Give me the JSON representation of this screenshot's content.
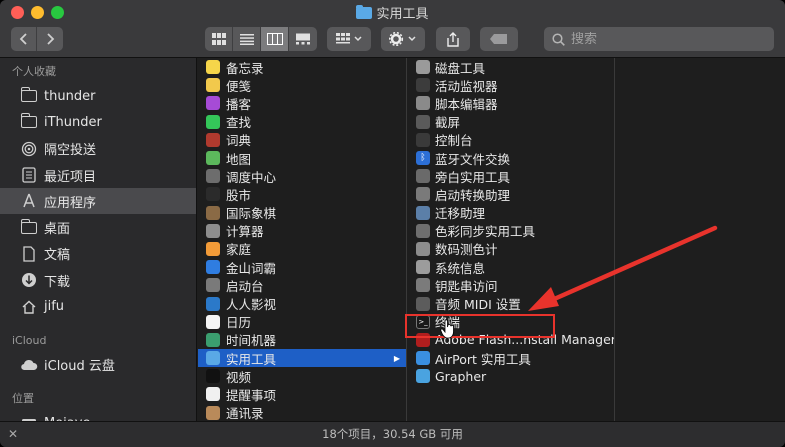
{
  "window": {
    "title": "实用工具"
  },
  "toolbar": {
    "search_placeholder": "搜索",
    "accent": "#1e5fc6"
  },
  "sidebar": {
    "favorites_title": "个人收藏",
    "favorites": [
      {
        "label": "thunder",
        "icon": "folder-icon"
      },
      {
        "label": "iThunder",
        "icon": "folder-icon"
      },
      {
        "label": "隔空投送",
        "icon": "airdrop-icon"
      },
      {
        "label": "最近项目",
        "icon": "recents-icon"
      },
      {
        "label": "应用程序",
        "icon": "applications-icon"
      },
      {
        "label": "桌面",
        "icon": "folder-icon"
      },
      {
        "label": "文稿",
        "icon": "document-icon"
      },
      {
        "label": "下载",
        "icon": "download-icon"
      },
      {
        "label": "jifu",
        "icon": "home-icon"
      }
    ],
    "icloud_title": "iCloud",
    "icloud": [
      {
        "label": "iCloud 云盘",
        "icon": "cloud-icon"
      }
    ],
    "locations_title": "位置",
    "locations": [
      {
        "label": "Mojave",
        "icon": "disk-icon"
      }
    ]
  },
  "applications": [
    {
      "label": "备忘录",
      "icon": "notes-icon",
      "color": "#f5d54a"
    },
    {
      "label": "便笺",
      "icon": "stickies-icon",
      "color": "#f2c94c"
    },
    {
      "label": "播客",
      "icon": "podcasts-icon",
      "color": "#a64bd6"
    },
    {
      "label": "查找",
      "icon": "findmy-icon",
      "color": "#34c759"
    },
    {
      "label": "词典",
      "icon": "dictionary-icon",
      "color": "#b03a2e"
    },
    {
      "label": "地图",
      "icon": "maps-icon",
      "color": "#5cb85c"
    },
    {
      "label": "调度中心",
      "icon": "mission-control-icon",
      "color": "#6d6d6d"
    },
    {
      "label": "股市",
      "icon": "stocks-icon",
      "color": "#2b2b2b"
    },
    {
      "label": "国际象棋",
      "icon": "chess-icon",
      "color": "#8a6a45"
    },
    {
      "label": "计算器",
      "icon": "calculator-icon",
      "color": "#8e8e8e"
    },
    {
      "label": "家庭",
      "icon": "home-app-icon",
      "color": "#f29b38"
    },
    {
      "label": "金山词霸",
      "icon": "kingsoft-icon",
      "color": "#2f7de1"
    },
    {
      "label": "启动台",
      "icon": "launchpad-icon",
      "color": "#7a7a7a"
    },
    {
      "label": "人人影视",
      "icon": "rrys-icon",
      "color": "#2b79c9"
    },
    {
      "label": "日历",
      "icon": "calendar-icon",
      "color": "#f4f4f4"
    },
    {
      "label": "时间机器",
      "icon": "time-machine-icon",
      "color": "#3b9e6f"
    },
    {
      "label": "实用工具",
      "icon": "utilities-folder-icon",
      "color": "#5aa9e6"
    },
    {
      "label": "视频",
      "icon": "tv-icon",
      "color": "#111111"
    },
    {
      "label": "提醒事项",
      "icon": "reminders-icon",
      "color": "#f0f0f0"
    },
    {
      "label": "通讯录",
      "icon": "contacts-icon",
      "color": "#b98a5a"
    }
  ],
  "utilities": [
    {
      "label": "磁盘工具",
      "icon": "disk-utility-icon",
      "color": "#9a9a9a"
    },
    {
      "label": "活动监视器",
      "icon": "activity-monitor-icon",
      "color": "#3c3c3c"
    },
    {
      "label": "脚本编辑器",
      "icon": "script-editor-icon",
      "color": "#8a8a8a"
    },
    {
      "label": "截屏",
      "icon": "screenshot-icon",
      "color": "#5a5a5a"
    },
    {
      "label": "控制台",
      "icon": "console-icon",
      "color": "#3a3a3a"
    },
    {
      "label": "蓝牙文件交换",
      "icon": "bluetooth-icon",
      "color": "#2c6fd6"
    },
    {
      "label": "旁白实用工具",
      "icon": "voiceover-icon",
      "color": "#6a6a6a"
    },
    {
      "label": "启动转换助理",
      "icon": "bootcamp-icon",
      "color": "#7a7a7a"
    },
    {
      "label": "迁移助理",
      "icon": "migration-icon",
      "color": "#5b7fa8"
    },
    {
      "label": "色彩同步实用工具",
      "icon": "colorsync-icon",
      "color": "#6f6f6f"
    },
    {
      "label": "数码测色计",
      "icon": "color-meter-icon",
      "color": "#8d8d8d"
    },
    {
      "label": "系统信息",
      "icon": "system-info-icon",
      "color": "#9c9c9c"
    },
    {
      "label": "钥匙串访问",
      "icon": "keychain-icon",
      "color": "#7b7b7b"
    },
    {
      "label": "音频 MIDI 设置",
      "icon": "audio-midi-icon",
      "color": "#5c5c5c"
    },
    {
      "label": "终端",
      "icon": "terminal-icon",
      "color": "#1a1a1a"
    },
    {
      "label": "Adobe Flash...nstall Manager",
      "icon": "flash-icon",
      "color": "#b01e1e"
    },
    {
      "label": "AirPort 实用工具",
      "icon": "airport-icon",
      "color": "#3a8fe0"
    },
    {
      "label": "Grapher",
      "icon": "grapher-icon",
      "color": "#4aa3e0"
    }
  ],
  "status": {
    "text": "18个项目，30.54 GB 可用"
  }
}
